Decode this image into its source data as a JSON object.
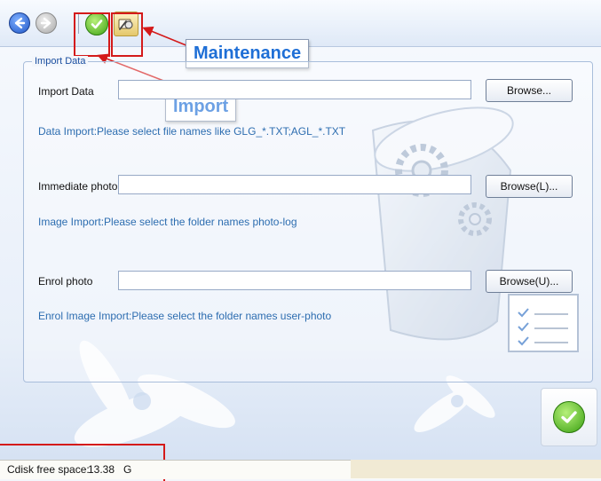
{
  "toolbar": {
    "back_icon": "back-arrow-icon",
    "forward_icon": "forward-arrow-icon",
    "import_icon": "green-check-icon",
    "maintenance_icon": "maintenance-tools-icon"
  },
  "annotations": {
    "maintenance": "Maintenance",
    "import": "Import",
    "highlight_color": "#d41a1a",
    "callout_color": "#1f6fd6"
  },
  "group": {
    "legend": "Import Data",
    "rows": [
      {
        "label": "Import Data",
        "value": "",
        "button": "Browse...",
        "hint": "Data Import:Please select file names like GLG_*.TXT;AGL_*.TXT"
      },
      {
        "label": "Immediate photo",
        "value": "",
        "button": "Browse(L)...",
        "hint": "Image Import:Please select the folder names photo-log"
      },
      {
        "label": "Enrol photo",
        "value": "",
        "button": "Browse(U)...",
        "hint": "Enrol Image Import:Please select the folder names user-photo"
      }
    ]
  },
  "ok_icon": "green-check-icon",
  "status": {
    "label": "Cdisk free space:",
    "value": "13.38   G"
  }
}
